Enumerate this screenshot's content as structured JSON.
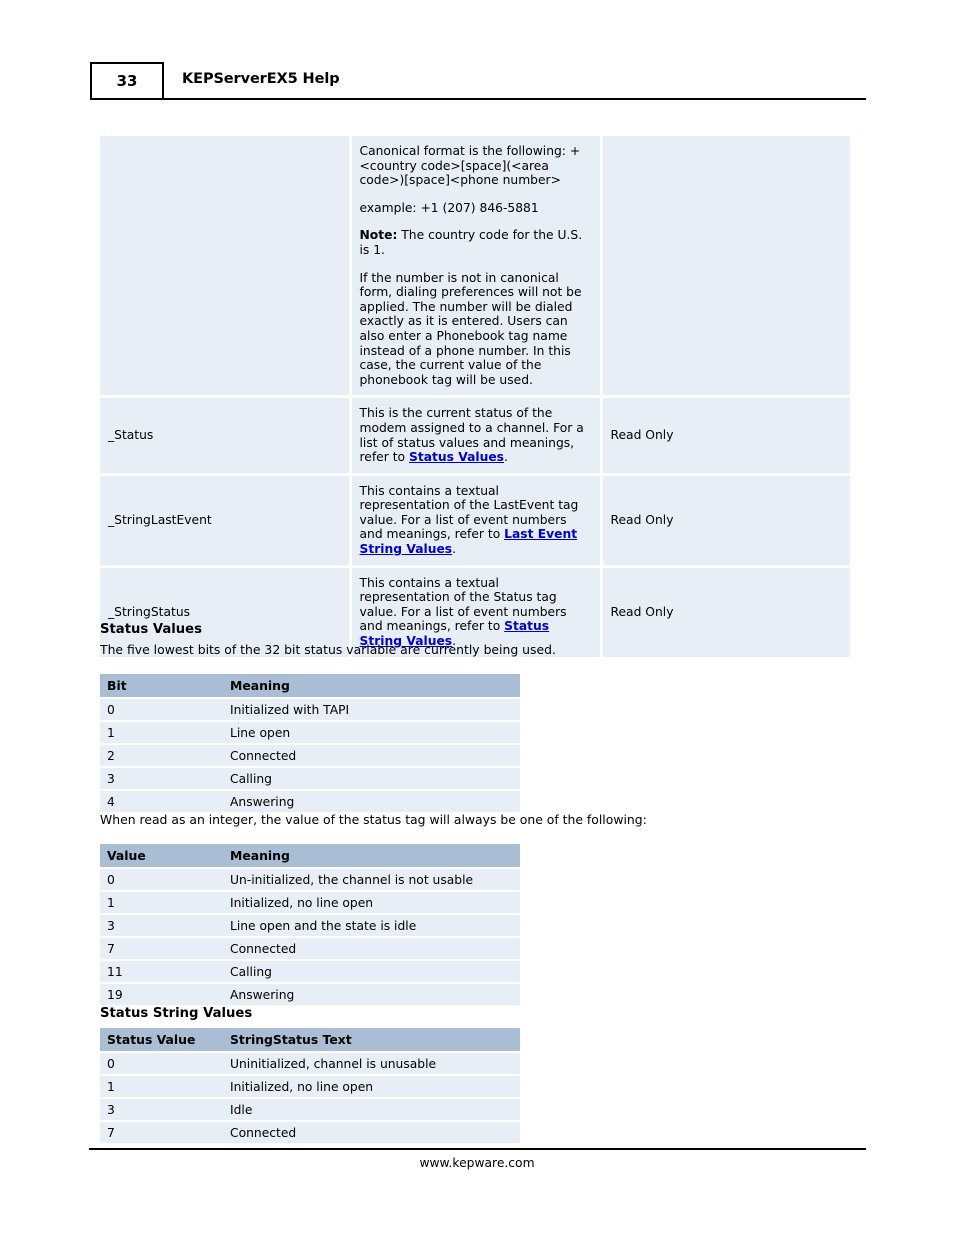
{
  "header": {
    "page_number": "33",
    "title": "KEPServerEX5 Help"
  },
  "desc_table": {
    "rows": [
      {
        "name": "",
        "access": "",
        "paragraphs": [
          "Canonical format is the following: +<country code>[space](<area code>)[space]<phone number>",
          "example: +1 (207) 846-5881",
          "Note: The country code for the U.S. is 1.",
          "If the number is not in canonical form, dialing preferences will not be applied. The number will be dialed exactly as it is entered. Users can also enter a Phonebook tag name instead of a phone number. In this case, the current value of the phonebook tag will be used."
        ],
        "note_label": "Note:",
        "note_rest": " The country code for the U.S. is 1."
      },
      {
        "name": "_Status",
        "desc_before": "This is the current status of the modem assigned to a channel. For a list of status values and meanings, refer to ",
        "link": "Status Values",
        "desc_after": ".",
        "access": "Read Only"
      },
      {
        "name": "_StringLastEvent",
        "desc_before": "This contains a textual representation of the LastEvent tag value. For a list of event numbers and meanings, refer to ",
        "link": "Last Event String Values",
        "desc_after": ".",
        "access": "Read Only"
      },
      {
        "name": "_StringStatus",
        "desc_before": "This contains a textual representation of the Status tag value. For a list of event numbers and meanings, refer to ",
        "link": "Status String Values",
        "desc_after": ".",
        "access": "Read Only"
      }
    ]
  },
  "status_values": {
    "heading": "Status Values",
    "intro": "The five lowest bits of the 32 bit status variable are currently being used.",
    "columns": [
      "Bit",
      "Meaning"
    ],
    "rows": [
      [
        "0",
        "Initialized with TAPI"
      ],
      [
        "1",
        "Line open"
      ],
      [
        "2",
        "Connected"
      ],
      [
        "3",
        "Calling"
      ],
      [
        "4",
        "Answering"
      ]
    ]
  },
  "integer_values": {
    "intro": "When read as an integer, the value of the status tag will always be one of the following:",
    "columns": [
      "Value",
      "Meaning"
    ],
    "rows": [
      [
        "0",
        "Un-initialized, the channel is not usable"
      ],
      [
        "1",
        "Initialized, no line open"
      ],
      [
        "3",
        "Line open and the state is idle"
      ],
      [
        "7",
        "Connected"
      ],
      [
        "11",
        "Calling"
      ],
      [
        "19",
        "Answering"
      ]
    ]
  },
  "status_string_values": {
    "heading": "Status String Values",
    "columns": [
      "Status Value",
      "StringStatus Text"
    ],
    "rows": [
      [
        "0",
        "Uninitialized, channel is unusable"
      ],
      [
        "1",
        "Initialized, no line open"
      ],
      [
        "3",
        "Idle"
      ],
      [
        "7",
        "Connected"
      ]
    ]
  },
  "footer": {
    "url": "www.kepware.com"
  },
  "colors": {
    "table_header_bg": "#a9bdd5",
    "table_cell_bg": "#e8eef6",
    "link": "#0000cc",
    "text": "#000000"
  }
}
